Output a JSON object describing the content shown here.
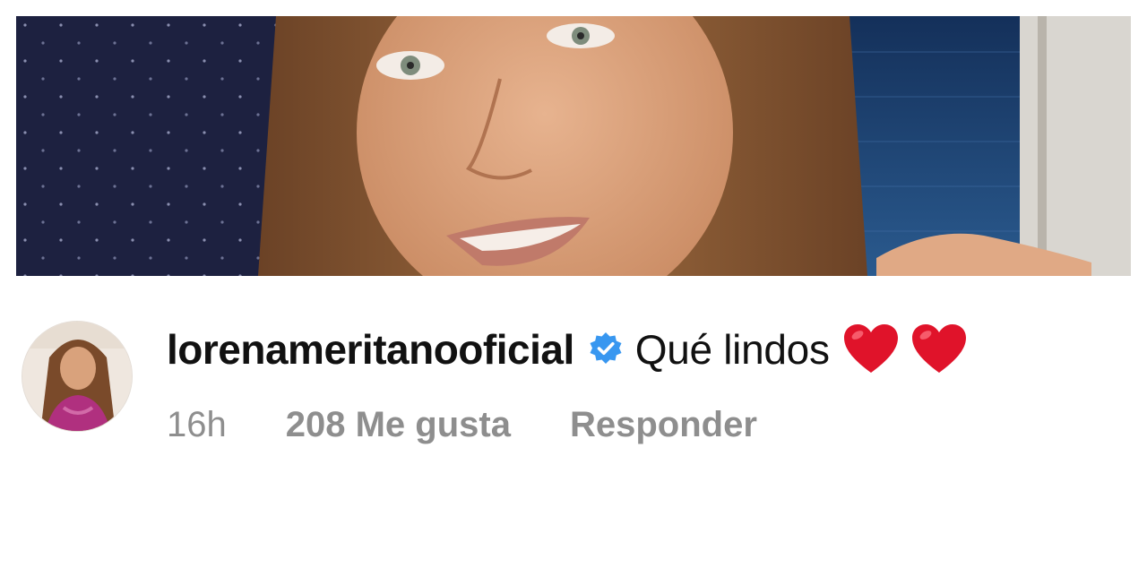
{
  "post": {
    "photo_name": "post-photo"
  },
  "comment": {
    "username": "lorenameritanooficial",
    "verified_icon": "verified-badge-icon",
    "text": "Qué lindos",
    "emojis": [
      "red-heart-icon",
      "red-heart-icon"
    ],
    "timestamp": "16h",
    "likes": "208 Me gusta",
    "reply_label": "Responder"
  },
  "colors": {
    "verified_blue": "#3897f0",
    "heart_red": "#e0132a",
    "meta_gray": "#8e8e8e",
    "text_dark": "#111111"
  }
}
